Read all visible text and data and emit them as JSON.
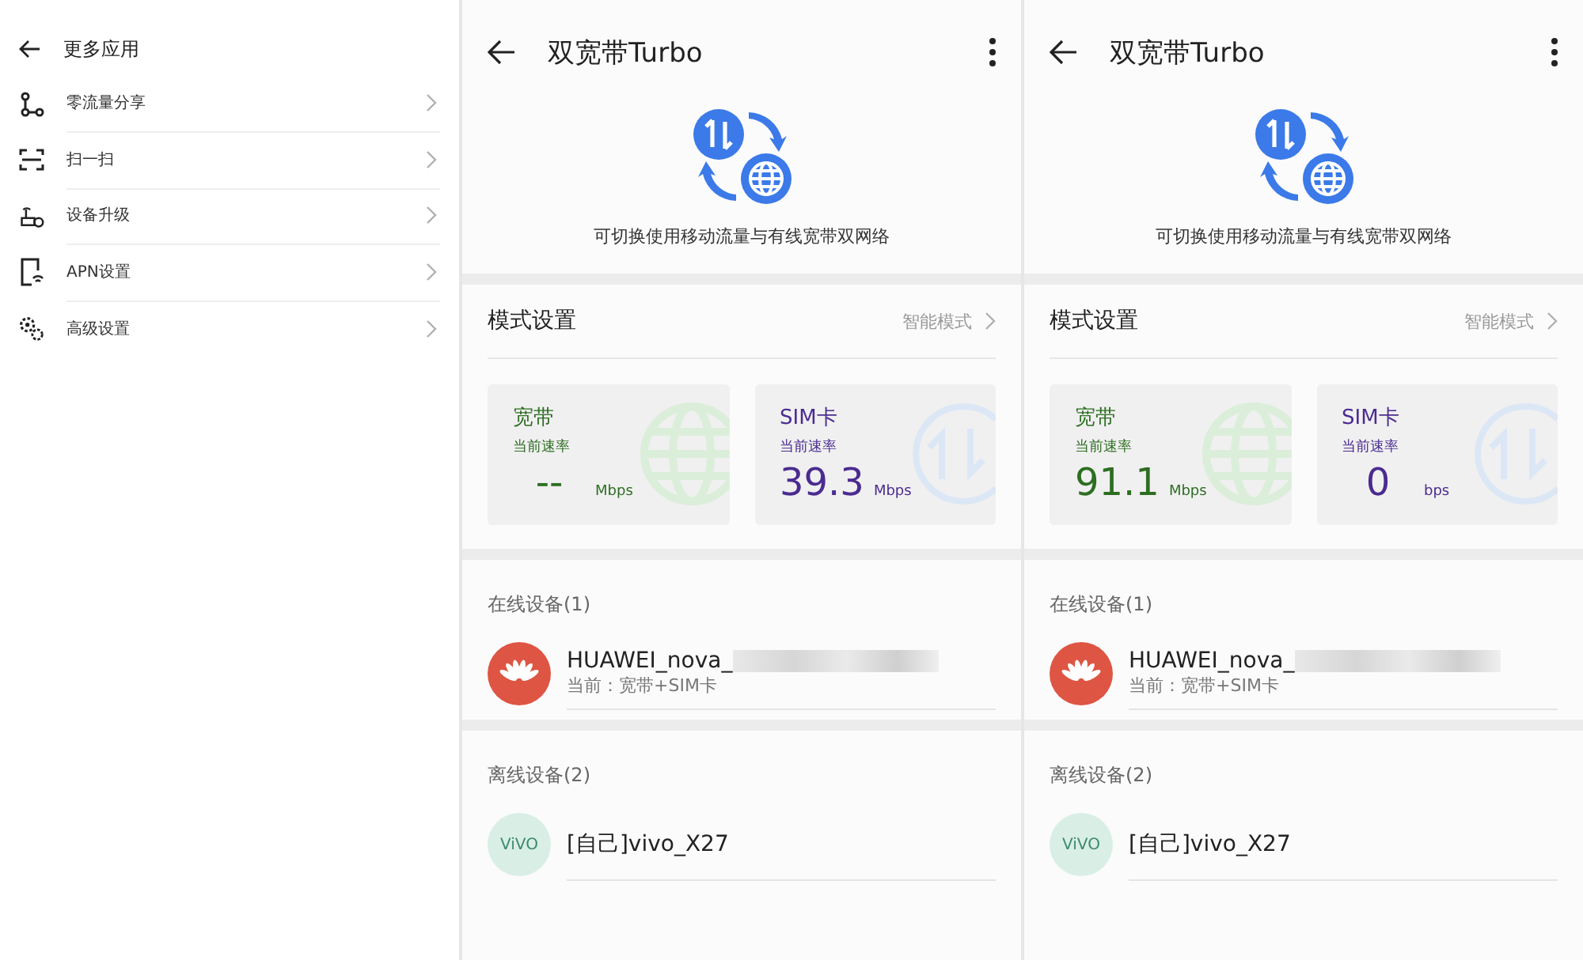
{
  "menu": {
    "title": "更多应用",
    "items": [
      {
        "kind": "share",
        "label": "零流量分享"
      },
      {
        "kind": "scan",
        "label": "扫一扫"
      },
      {
        "kind": "upgrade",
        "label": "设备升级"
      },
      {
        "kind": "apn",
        "label": "APN设置"
      },
      {
        "kind": "settings",
        "label": "高级设置"
      }
    ]
  },
  "panels": [
    {
      "title": "双宽带Turbo",
      "description": "可切换使用移动流量与有线宽带双网络",
      "mode_label": "模式设置",
      "mode_value": "智能模式",
      "cards": [
        {
          "kind": "broadband",
          "name": "宽带",
          "rate_label": "当前速率",
          "value": "--",
          "unit": "Mbps"
        },
        {
          "kind": "sim",
          "name": "SIM卡",
          "rate_label": "当前速率",
          "value": "39.3",
          "unit": "Mbps"
        }
      ],
      "online_heading": "在线设备(1)",
      "online_devices": [
        {
          "name": "HUAWEI_nova_",
          "status": "当前：宽带+SIM卡"
        }
      ],
      "offline_heading": "离线设备(2)",
      "offline_devices": [
        {
          "name": "[自己]vivo_X27",
          "logo": "ViVO"
        }
      ]
    },
    {
      "title": "双宽带Turbo",
      "description": "可切换使用移动流量与有线宽带双网络",
      "mode_label": "模式设置",
      "mode_value": "智能模式",
      "cards": [
        {
          "kind": "broadband",
          "name": "宽带",
          "rate_label": "当前速率",
          "value": "91.1",
          "unit": "Mbps"
        },
        {
          "kind": "sim",
          "name": "SIM卡",
          "rate_label": "当前速率",
          "value": "0",
          "unit": "bps"
        }
      ],
      "online_heading": "在线设备(1)",
      "online_devices": [
        {
          "name": "HUAWEI_nova_",
          "status": "当前：宽带+SIM卡"
        }
      ],
      "offline_heading": "离线设备(2)",
      "offline_devices": [
        {
          "name": "[自己]vivo_X27",
          "logo": "ViVO"
        }
      ]
    }
  ]
}
